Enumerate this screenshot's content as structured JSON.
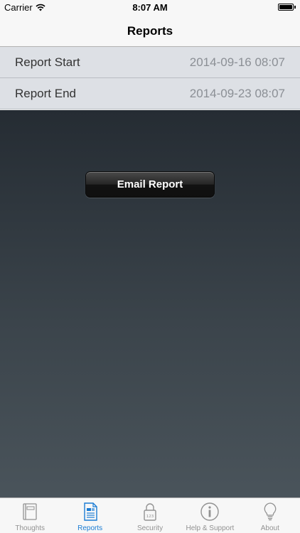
{
  "status_bar": {
    "carrier": "Carrier",
    "time": "8:07 AM"
  },
  "nav": {
    "title": "Reports"
  },
  "rows": [
    {
      "label": "Report Start",
      "value": "2014-09-16 08:07"
    },
    {
      "label": "Report End",
      "value": "2014-09-23 08:07"
    }
  ],
  "email_button": {
    "label": "Email Report"
  },
  "tabs": [
    {
      "label": "Thoughts",
      "icon": "notebook-icon"
    },
    {
      "label": "Reports",
      "icon": "document-icon",
      "active": true
    },
    {
      "label": "Security",
      "icon": "lock-icon"
    },
    {
      "label": "Help & Support",
      "icon": "info-icon"
    },
    {
      "label": "About",
      "icon": "lightbulb-icon"
    }
  ],
  "colors": {
    "accent": "#1a7cd4",
    "inactive": "#929292"
  }
}
